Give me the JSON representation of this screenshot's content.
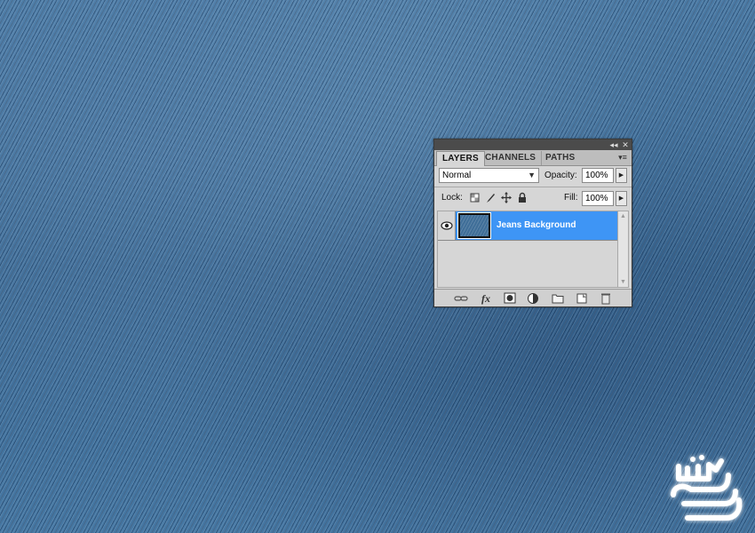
{
  "document": {
    "background": "denim texture"
  },
  "panel": {
    "titlebar": {
      "collapse_icon": "double-chevron-left-icon",
      "close_icon": "close-icon",
      "collapse_glyph": "◂◂",
      "close_glyph": "✕"
    },
    "tabs": [
      {
        "label": "LAYERS",
        "active": true
      },
      {
        "label": "CHANNELS",
        "active": false
      },
      {
        "label": "PATHS",
        "active": false
      }
    ],
    "menu_glyph": "▾≡",
    "blend_mode": {
      "value": "Normal"
    },
    "opacity": {
      "label": "Opacity:",
      "value": "100%"
    },
    "lock": {
      "label": "Lock:"
    },
    "fill": {
      "label": "Fill:",
      "value": "100%"
    },
    "layers": [
      {
        "name": "Jeans Background",
        "visible": true,
        "selected": true
      }
    ],
    "bottom_icons": [
      "link-layers-icon",
      "fx-icon",
      "add-mask-icon",
      "adjustment-layer-icon",
      "new-group-icon",
      "new-layer-icon",
      "delete-icon"
    ],
    "fx_label": "fx"
  },
  "colors": {
    "selection": "#3e95f5",
    "panel_bg": "#d6d6d6",
    "denim": "#3f6e98"
  }
}
